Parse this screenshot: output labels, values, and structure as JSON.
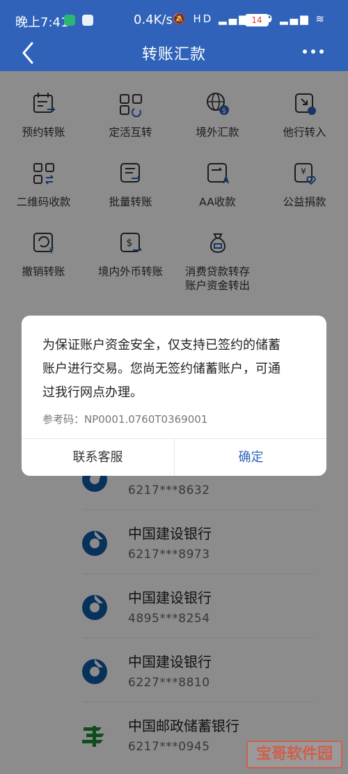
{
  "status_bar": {
    "time": "晚上7:41",
    "speed": "0.4K/s",
    "icons": "🔕 HD ▂▄▆ HD ▂▄▆ ≋",
    "battery": "14"
  },
  "nav": {
    "title": "转账汇款",
    "back_icon": "chevron-left-icon",
    "more_icon": "more-icon"
  },
  "grid": {
    "items": [
      {
        "label": "预约转账"
      },
      {
        "label": "定活互转"
      },
      {
        "label": "境外汇款"
      },
      {
        "label": "他行转入"
      },
      {
        "label": "二维码收款"
      },
      {
        "label": "批量转账"
      },
      {
        "label": "AA收款"
      },
      {
        "label": "公益捐款"
      },
      {
        "label": "撤销转账"
      },
      {
        "label": "境内外币转账"
      },
      {
        "label": "消费贷款转存"
      },
      {
        "label": "账户资金转出"
      }
    ]
  },
  "accounts": [
    {
      "bank": "",
      "number": "6217***8632"
    },
    {
      "bank": "中国建设银行",
      "number": "6217***8973"
    },
    {
      "bank": "中国建设银行",
      "number": "4895***8254"
    },
    {
      "bank": "中国建设银行",
      "number": "6227***8810"
    },
    {
      "bank": "中国邮政储蓄银行",
      "number": "6217***0945"
    }
  ],
  "dialog": {
    "message_line1": "为保证账户资金安全，仅支持已签约的储蓄",
    "message_line2": "账户进行交易。您尚无签约储蓄账户，可通",
    "message_line3": "过我行网点办理。",
    "reference": "参考码：NP0001.0760T0369001",
    "left_button": "联系客服",
    "right_button": "确定"
  },
  "watermark": "宝哥软件园",
  "colors": {
    "primary": "#2f62b8",
    "ccb_blue": "#0f5aa6",
    "postal_green": "#1e8a3a",
    "battery_red": "#e53935"
  }
}
